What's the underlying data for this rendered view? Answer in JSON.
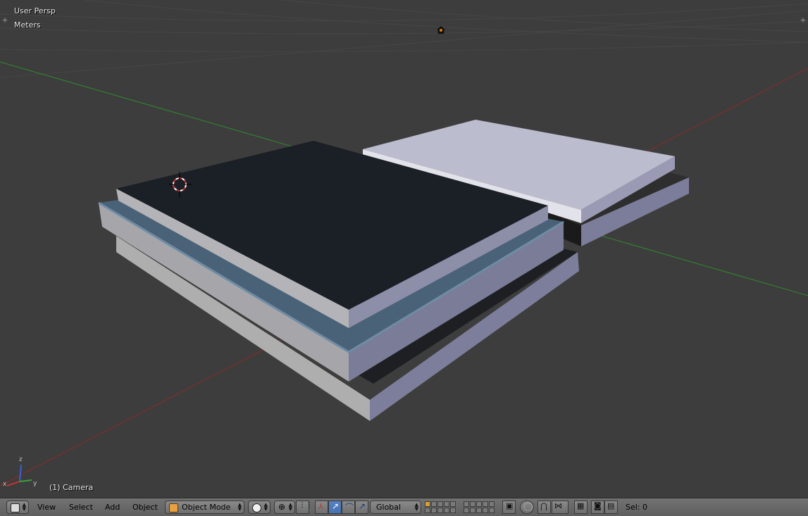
{
  "viewport": {
    "view_name": "User Persp",
    "units": "Meters",
    "object_label": "(1) Camera"
  },
  "header": {
    "menus": [
      "View",
      "Select",
      "Add",
      "Object"
    ],
    "mode": "Object Mode",
    "orientation": "Global",
    "selection": "Sel: 0"
  },
  "axes": {
    "z": "z",
    "y": "y",
    "x": "x"
  },
  "colors": {
    "background": "#3d3d3d",
    "header": "#6a6a6a",
    "x_axis": "#8a2b2b",
    "y_axis": "#2f8a2f",
    "active_button": "#5680c2"
  }
}
